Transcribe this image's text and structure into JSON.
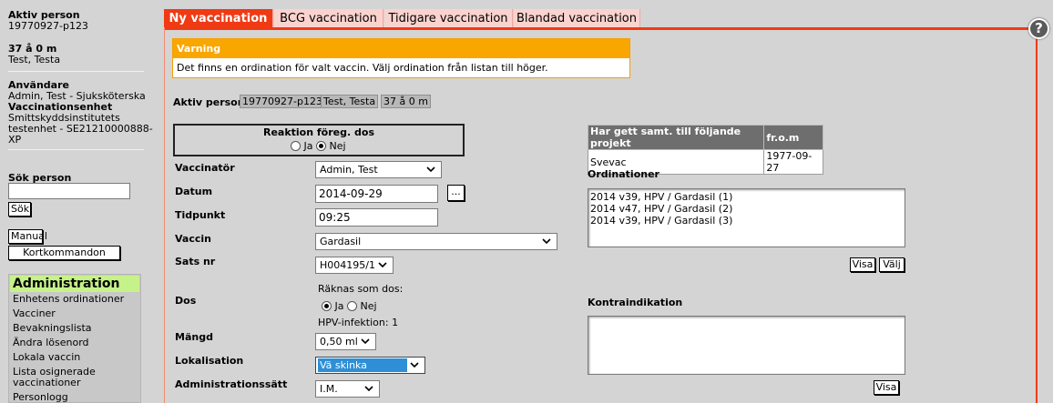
{
  "sidebar": {
    "active_person_label": "Aktiv person",
    "active_person_id": "19770927-p123",
    "age": "37 å 0 m",
    "name": "Test, Testa",
    "user_label": "Användare",
    "user": "Admin, Test - Sjuksköterska",
    "unit_label": "Vaccinationsenhet",
    "unit_lines": [
      "Smittskyddsinstitutets",
      "testenhet - SE21210000888-",
      "XP"
    ],
    "search_label": "Sök person",
    "search_button": "Sök",
    "manual_button": "Manual",
    "shortcuts_button": "Kortkommandon",
    "admin_title": "Administration",
    "admin_items": [
      "Enhetens ordinationer",
      "Vacciner",
      "Bevakningslista",
      "Ändra lösenord",
      "Lokala vaccin",
      "Lista osignerade",
      "vaccinationer",
      "Personlogg"
    ]
  },
  "tabs": [
    "Ny vaccination",
    "BCG vaccination",
    "Tidigare vaccination",
    "Blandad vaccination"
  ],
  "help_icon": "?",
  "warning": {
    "title": "Varning",
    "text": "Det finns en ordination för valt vaccin. Välj ordination från listan till höger."
  },
  "active_person": {
    "label": "Aktiv person",
    "id": "19770927-p123",
    "name": "Test, Testa",
    "age": "37 å 0 m"
  },
  "reaction": {
    "label": "Reaktion föreg. dos",
    "yes": "Ja",
    "no": "Nej",
    "selected": "Nej"
  },
  "form": {
    "vaccinator_label": "Vaccinatör",
    "vaccinator_value": "Admin, Test",
    "date_label": "Datum",
    "date_value": "2014-09-29",
    "date_button": "...",
    "time_label": "Tidpunkt",
    "time_value": "09:25",
    "vaccine_label": "Vaccin",
    "vaccine_value": "Gardasil",
    "batch_label": "Sats nr",
    "batch_value": "H004195/1",
    "dose_label": "Dos",
    "counts_as_dose": "Räknas som dos:",
    "dose_yes": "Ja",
    "dose_no": "Nej",
    "hpv_info": "HPV-infektion: 1",
    "amount_label": "Mängd",
    "amount_value": "0,50 ml",
    "location_label": "Lokalisation",
    "location_value": "Vä skinka",
    "method_label": "Administrationssätt",
    "method_value": "I.M."
  },
  "projects": {
    "headers": [
      "Har gett samt. till följande projekt",
      "fr.o.m"
    ],
    "rows": [
      [
        "Svevac",
        "1977-09-27"
      ]
    ]
  },
  "ordinations": {
    "label": "Ordinationer",
    "items": [
      "2014 v39, HPV / Gardasil (1)",
      "2014 v47, HPV / Gardasil (2)",
      "2014 v39, HPV / Gardasil (3)"
    ],
    "show_button": "Visa",
    "select_button": "Välj"
  },
  "contraindication": {
    "label": "Kontraindikation",
    "show_button": "Visa"
  },
  "colors": {
    "accent": "#f03a14",
    "warning": "#f9a600",
    "admin_header": "#c6f28a",
    "selected_field": "#2e8fd6"
  }
}
